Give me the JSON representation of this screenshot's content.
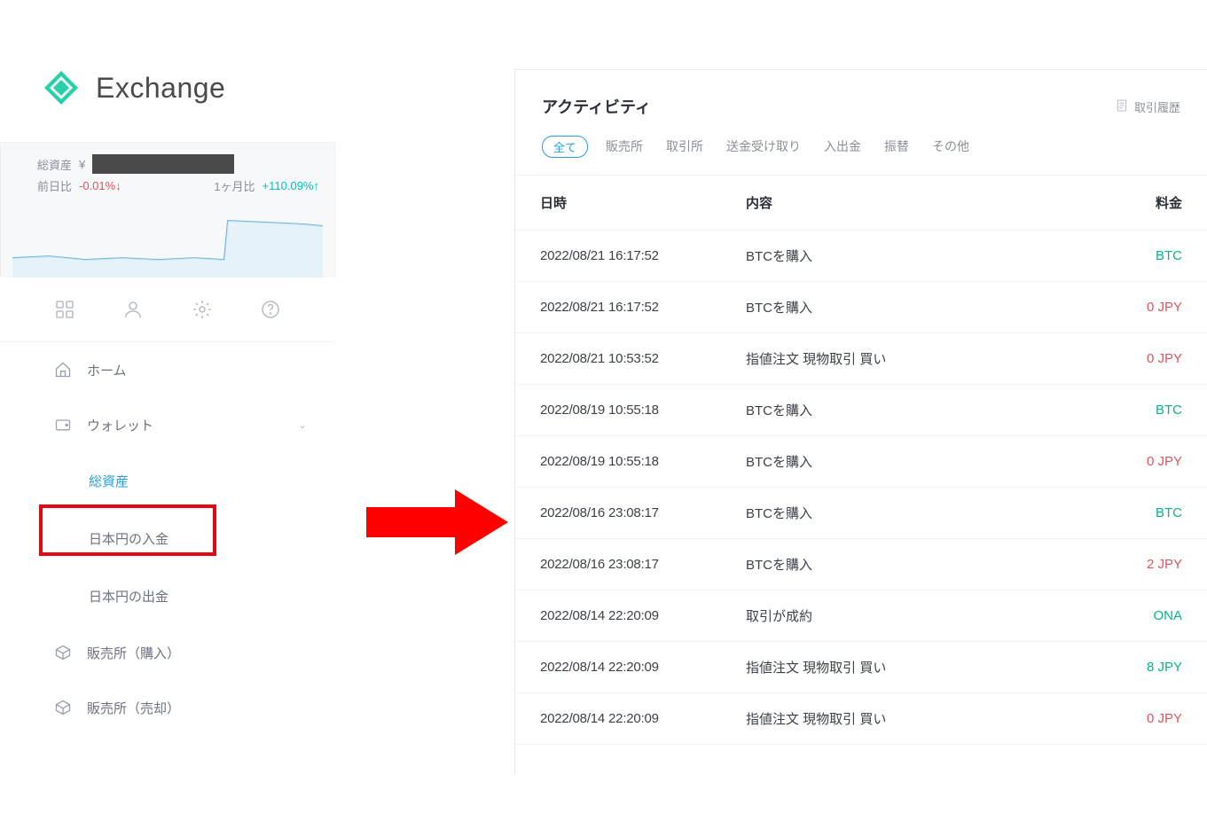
{
  "brand": {
    "name": "Exchange"
  },
  "portfolio": {
    "total_label": "総資産",
    "currency_symbol": "¥",
    "day_label": "前日比",
    "day_change": "-0.01%↓",
    "month_label": "1ヶ月比",
    "month_change": "+110.09%↑"
  },
  "nav": {
    "home": "ホーム",
    "wallet": "ウォレット",
    "sub_total_assets": "総資産",
    "sub_deposit_jpy": "日本円の入金",
    "sub_withdraw_jpy": "日本円の出金",
    "sub_sales_buy": "販売所（購入）",
    "sub_sales_sell": "販売所（売却）"
  },
  "activity": {
    "title": "アクティビティ",
    "history_link": "取引履歴",
    "filters": [
      "全て",
      "販売所",
      "取引所",
      "送金受け取り",
      "入出金",
      "振替",
      "その他"
    ],
    "headers": {
      "datetime": "日時",
      "desc": "内容",
      "fee": "料金"
    },
    "rows": [
      {
        "dt": "2022/08/21 16:17:52",
        "desc": "BTCを購入",
        "cur": "BTC",
        "cur_cls": "green"
      },
      {
        "dt": "2022/08/21 16:17:52",
        "desc": "BTCを購入",
        "cur": "0 JPY",
        "cur_cls": "red"
      },
      {
        "dt": "2022/08/21 10:53:52",
        "desc": "指値注文 現物取引 買い",
        "cur": "0 JPY",
        "cur_cls": "red"
      },
      {
        "dt": "2022/08/19 10:55:18",
        "desc": "BTCを購入",
        "cur": "BTC",
        "cur_cls": "green"
      },
      {
        "dt": "2022/08/19 10:55:18",
        "desc": "BTCを購入",
        "cur": "0 JPY",
        "cur_cls": "red"
      },
      {
        "dt": "2022/08/16 23:08:17",
        "desc": "BTCを購入",
        "cur": "BTC",
        "cur_cls": "green"
      },
      {
        "dt": "2022/08/16 23:08:17",
        "desc": "BTCを購入",
        "cur": "2 JPY",
        "cur_cls": "red"
      },
      {
        "dt": "2022/08/14 22:20:09",
        "desc": "取引が成約",
        "cur": "ONA",
        "cur_cls": "green"
      },
      {
        "dt": "2022/08/14 22:20:09",
        "desc": "指値注文 現物取引 買い",
        "cur": "8 JPY",
        "cur_cls": "green"
      },
      {
        "dt": "2022/08/14 22:20:09",
        "desc": "指値注文 現物取引 買い",
        "cur": "0 JPY",
        "cur_cls": "red"
      }
    ]
  }
}
